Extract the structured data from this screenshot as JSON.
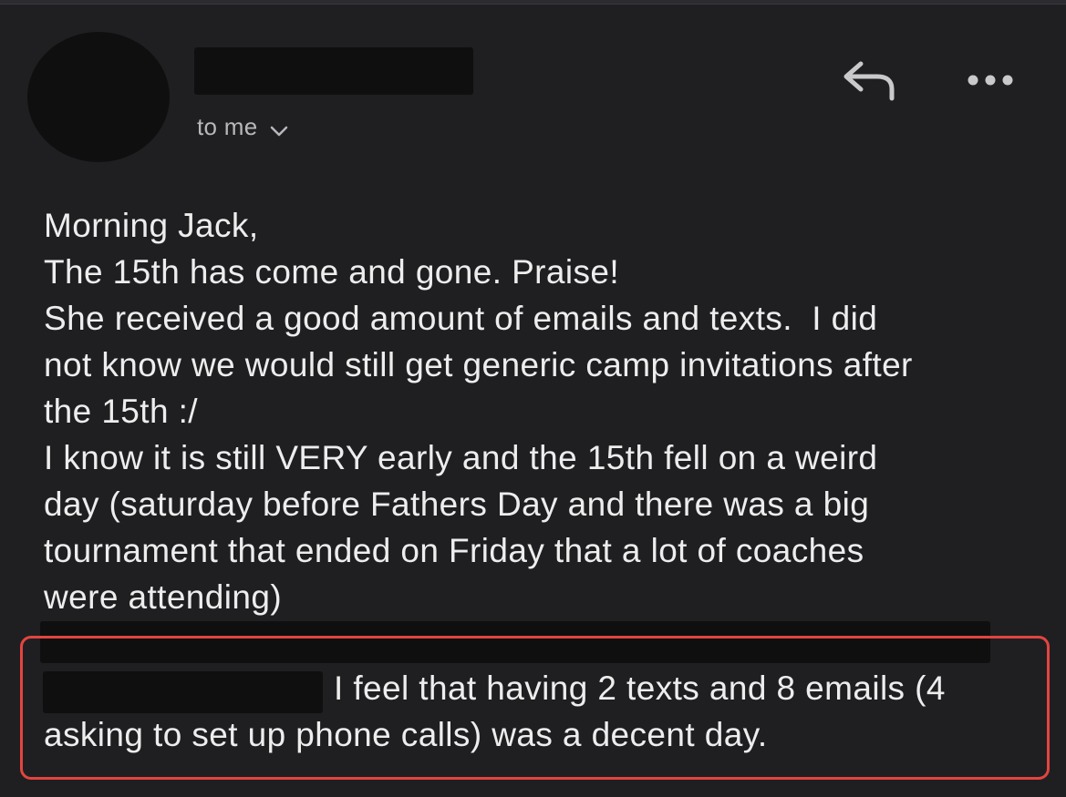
{
  "header": {
    "recipient_label": "to me",
    "icons": {
      "reply": "reply-icon",
      "more": "more-options-icon",
      "chevron": "chevron-down-icon"
    }
  },
  "email": {
    "lines": [
      "Morning Jack,",
      "The 15th has come and gone. Praise!",
      "She received a good amount of emails and texts.  I did",
      "not know we would still get generic camp invitations after",
      "the 15th :/",
      "I know it is still VERY early and the 15th fell on a weird",
      "day (saturday before Fathers Day and there was a big",
      "tournament that ended on Friday that a lot of coaches",
      "were attending)"
    ],
    "highlight_lines": [
      "I feel that having 2 texts and 8 emails (4",
      "asking to set up phone calls) was a decent day."
    ]
  },
  "colors": {
    "background": "#1f1f22",
    "text": "#ededed",
    "highlight_border": "#e2453f",
    "redaction": "#0f0f10"
  }
}
